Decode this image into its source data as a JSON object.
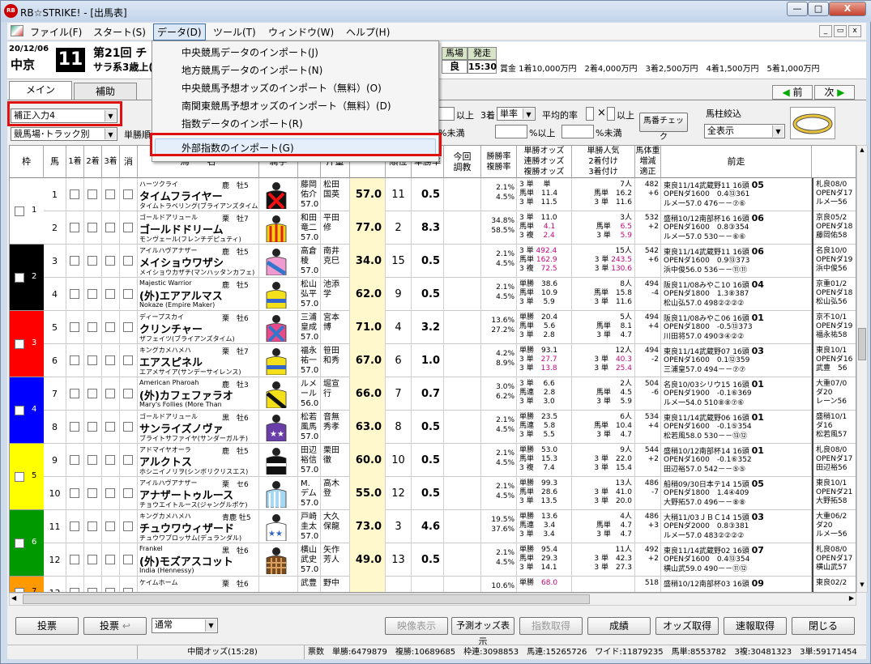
{
  "window": {
    "title": "RB☆STRIKE! - [出馬表]",
    "app_icon": "RB",
    "min": "—",
    "max": "□",
    "close": "X",
    "mdi_min": "_",
    "mdi_restore": "▭",
    "mdi_close": "x"
  },
  "menu": [
    {
      "label": "ファイル(F)"
    },
    {
      "label": "スタート(S)"
    },
    {
      "label": "データ(D)",
      "active": true
    },
    {
      "label": "ツール(T)"
    },
    {
      "label": "ウィンドウ(W)"
    },
    {
      "label": "ヘルプ(H)"
    }
  ],
  "data_menu": {
    "items": [
      "中央競馬データのインポート(J)",
      "地方競馬データのインポート(N)",
      "中央競馬予想オッズのインポート（無料）(O)",
      "南関東競馬予想オッズのインポート（無料）(D)",
      "指数データのインポート(R)",
      "外部指数のインポート(G)"
    ],
    "highlighted_index": 5
  },
  "race": {
    "date": "20/12/06",
    "venue": "中京",
    "number": "11",
    "title": "第21回 チ",
    "cond": "サラ系3歳上(",
    "baba_label": "馬場",
    "baba_value": "良",
    "start_label": "発走",
    "start_value": "15:30",
    "prize": "賞金 1着10,000万円　2着4,000万円　3着2,500万円　4着1,500万円　5着1,000万円"
  },
  "tabs": [
    "メイン",
    "補助"
  ],
  "nav": {
    "prev": "前",
    "next": "次"
  },
  "controls": {
    "correction_select": "補正入力4",
    "baba_track_select": "競馬場･トラック別",
    "win_label": "単勝順",
    "ijo1": "以上",
    "third_label": "3着",
    "rate_select": "単率",
    "avg_rate_label": "平均的率",
    "times": "×",
    "ijo2": "以上",
    "miman1": "%未満",
    "ijo_pct": "%以上",
    "miman2": "%未満",
    "baba_check_btn": "馬番チェック",
    "bachu_label": "馬柱絞込",
    "bachu_select": "全表示"
  },
  "grid_headers": [
    "枠",
    "馬",
    "1着",
    "2着",
    "3着",
    "消",
    "馬　　名",
    "騎手",
    "斤量",
    "順位",
    "単勝率",
    "今回\n調教",
    "勝勝率\n複勝率",
    "単勝オッズ\n連勝オッズ\n複勝オッズ",
    "単勝人気\n2着付け\n3着付け",
    "馬体重\n増減\n適正",
    "前走"
  ],
  "rows": [
    {
      "waku": "1",
      "waku_color": "#ffffff",
      "num": "1",
      "sire": "ハーツクライ",
      "sex": "鹿　牡5",
      "name": "タイムフライヤー",
      "dam": "タイムトラベリング(ブライアンズタイム)",
      "jockey": "藤岡\n佑介\n57.0",
      "trainer": "松田\n国英",
      "wt": "57.0",
      "rank": "11",
      "win": "0.5",
      "p1": "2.1%",
      "p2": "4.5%",
      "odds": "3 単　 単　\n馬単　11.4\n3 単　11.5",
      "pop": "7人\n馬単　16.2\n3 単　11.6",
      "body": "482\n+6",
      "zen": "東良11/14武蔵野11 16頭",
      "zen_no": "05",
      "zen2": "OPENダ1600　0.4⑬361",
      "zen3": "ルメ一57.0 476－－⑦⑥",
      "next": "札良08/0\nOPENダ17\nルメ一56",
      "silk": "x-red"
    },
    {
      "waku": "1",
      "waku_color": "#ffffff",
      "num": "2",
      "sire": "ゴールドアリュール",
      "sex": "栗　牡7",
      "name": "ゴールドドリーム",
      "dam": "モンヴェール(フレンチデピュティ)",
      "jockey": "和田\n竜二\n57.0",
      "trainer": "平田\n修",
      "wt": "77.0",
      "rank": "2",
      "win": "8.3",
      "p1": "34.8%",
      "p2": "58.5%",
      "odds": "3 単　11.0\n馬単　 4.1\n3 複　 2.4",
      "pop": "3人\n馬単　 6.5\n3 単　 5.9",
      "body": "532\n+2",
      "zen": "盛稍10/12南部杯16 16頭",
      "zen_no": "06",
      "zen2": "OPENダ1600　0.8③354",
      "zen3": "ルメ一57.0 530－－⑥⑥",
      "next": "京良05/2\nOPENダ18\n藤岡佑58",
      "silk": "stripe-yr"
    },
    {
      "waku": "2",
      "waku_color": "#000000",
      "num": "3",
      "sire": "アイルハヴアナザー",
      "sex": "鹿　牡5",
      "name": "メイショウワザシ",
      "dam": "メイショウカザチ(マンハッタンカフェ)",
      "jockey": "高倉\n稜\n57.0",
      "trainer": "南井\n克巳",
      "wt": "34.0",
      "rank": "15",
      "win": "0.5",
      "p1": "2.1%",
      "p2": "4.5%",
      "odds": "3 単 492.4\n馬単 162.9\n3 複　72.5",
      "pop": "15人\n3 単 243.5\n3 単 130.6",
      "body": "542\n+6",
      "zen": "東良11/14武蔵野11 16頭",
      "zen_no": "06",
      "zen2": "OPENダ1600　0.9⑬373",
      "zen3": "浜中俊56.0 536－－⑪⑪",
      "next": "名良10/0\nOPENダ19\n浜中俊56",
      "silk": "pink-blue"
    },
    {
      "waku": "2",
      "waku_color": "#000000",
      "num": "4",
      "sire": "Majestic Warrior",
      "sex": "鹿　牡5",
      "name": "(外)エアアルマス",
      "dam": "Nokaze (Empire Maker)",
      "jockey": "松山\n弘平\n57.0",
      "trainer": "池添\n学",
      "wt": "62.0",
      "rank": "9",
      "win": "0.5",
      "p1": "2.1%",
      "p2": "4.5%",
      "odds": "単勝　38.6\n馬単　10.9\n3 単　 5.9",
      "pop": "8人\n馬単　15.8\n3 単　11.6",
      "body": "494\n-4",
      "zen": "阪良11/08みやこ10 16頭",
      "zen_no": "04",
      "zen2": "OPENダ1800　1.3⑧387",
      "zen3": "松山弘57.0 498②②②②",
      "next": "京重01/2\nOPENダ18\n松山弘56",
      "silk": "yellow"
    },
    {
      "waku": "3",
      "waku_color": "#ff0000",
      "num": "5",
      "sire": "ディープスカイ",
      "sex": "栗　牡6",
      "name": "クリンチャー",
      "dam": "ザフェイツ(ブライアンズタイム)",
      "jockey": "三浦\n皇成\n57.0",
      "trainer": "宮本\n博",
      "wt": "71.0",
      "rank": "4",
      "win": "3.2",
      "p1": "13.6%",
      "p2": "27.2%",
      "odds": "単勝　20.4\n馬単　 5.6\n3 単　 2.8",
      "pop": "5人\n馬単　 8.1\n3 単　 4.7",
      "body": "494\n+4",
      "zen": "阪良11/08みやこ06 16頭",
      "zen_no": "01",
      "zen2": "OPENダ1800　-0.5⑬373",
      "zen3": "川田将57.0 490③④②②",
      "next": "京不10/1\nOPENダ19\n福永祐58",
      "silk": "x-blue"
    },
    {
      "waku": "3",
      "waku_color": "#ff0000",
      "num": "6",
      "sire": "キングカメハメハ",
      "sex": "栗　牡7",
      "name": "エアスピネル",
      "dam": "エアメサイア(サンデーサイレンス)",
      "jockey": "福永\n祐一\n57.0",
      "trainer": "笹田\n和秀",
      "wt": "67.0",
      "rank": "6",
      "win": "1.0",
      "p1": "4.2%",
      "p2": "8.9%",
      "odds": "単勝　93.1\n3 単　27.7\n3 単　13.8",
      "pop": "12人\n3 単　40.3\n3 単　25.4",
      "body": "494\n-2",
      "zen": "東良11/14武蔵野07 16頭",
      "zen_no": "03",
      "zen2": "OPENダ1600　0.1⑫359",
      "zen3": "三浦皇57.0 494－－⑦⑦",
      "next": "東良10/1\nOPENダ16\n武豊　56",
      "silk": "yellow-dot"
    },
    {
      "waku": "4",
      "waku_color": "#0000ff",
      "num": "7",
      "sire": "American Pharoah",
      "sex": "鹿　牡3",
      "name": "(外)カフェファラオ",
      "dam": "Mary's Follies (More Than",
      "jockey": "ルメ\nール\n56.0",
      "trainer": "堀宣\n行",
      "wt": "66.0",
      "rank": "7",
      "win": "0.7",
      "p1": "3.0%",
      "p2": "6.2%",
      "odds": "3 単　 6.6\n馬連　 2.8\n3 単　 3.0",
      "pop": "2人\n馬単　 4.5\n3 単　 5.9",
      "body": "504\n-6",
      "zen": "名良10/03シリウ15 16頭",
      "zen_no": "01",
      "zen2": "OPENダ1900　-0.1⑥369",
      "zen3": "ルメ一54.0 510⑧⑧⑦⑥",
      "next": "大重07/0\nダ20\nレーン56",
      "silk": "yellow-black"
    },
    {
      "waku": "4",
      "waku_color": "#0000ff",
      "num": "8",
      "sire": "ゴールドアリュール",
      "sex": "黒　牡6",
      "name": "サンライズノヴァ",
      "dam": "ブライトサファイヤ(サンダーガルチ)",
      "jockey": "松若\n風馬\n57.0",
      "trainer": "音無\n秀孝",
      "wt": "63.0",
      "rank": "8",
      "win": "0.5",
      "p1": "2.1%",
      "p2": "4.5%",
      "odds": "単勝　23.5\n馬連　 5.8\n3 単　 5.5",
      "pop": "6人\n馬単　10.4\n3 単　 4.7",
      "body": "534\n+4",
      "zen": "東良11/14武蔵野06 16頭",
      "zen_no": "01",
      "zen2": "OPENダ1600　-0.1⑤354",
      "zen3": "松若風58.0 530－－⑬⑫",
      "next": "盛稍10/1\nダ16\n松若風57",
      "silk": "purple-star"
    },
    {
      "waku": "5",
      "waku_color": "#ffff00",
      "num": "9",
      "sire": "アドマイヤオーラ",
      "sex": "鹿　牡5",
      "name": "アルクトス",
      "dam": "ホシニイノリヲ(シンボリクリスエス)",
      "jockey": "田辺\n裕信\n57.0",
      "trainer": "栗田\n徹",
      "wt": "60.0",
      "rank": "10",
      "win": "0.5",
      "p1": "2.1%",
      "p2": "4.5%",
      "odds": "単勝　53.0\n馬単　15.3\n3 複　 7.4",
      "pop": "9人\n3 単　22.0\n3 単　15.4",
      "body": "544\n+2",
      "zen": "盛稍10/12南部杯14 16頭",
      "zen_no": "01",
      "zen2": "OPENダ1600　-0.1⑥352",
      "zen3": "田辺裕57.0 542－－⑤⑤",
      "next": "札良08/0\nOPENダ17\n田辺裕56",
      "silk": "black-white"
    },
    {
      "waku": "5",
      "waku_color": "#ffff00",
      "num": "10",
      "sire": "アイルハヴアナザー",
      "sex": "栗　セ6",
      "name": "アナザートゥルース",
      "dam": "チョウエイトルース(ジャングルポケ)",
      "jockey": "M.\nデム\n57.0",
      "trainer": "高木\n登",
      "wt": "55.0",
      "rank": "12",
      "win": "0.5",
      "p1": "2.1%",
      "p2": "4.5%",
      "odds": "単勝　99.3\n馬単　28.6\n3 単　13.5",
      "pop": "13人\n3 単　41.0\n3 単　20.0",
      "body": "486\n-7",
      "zen": "船稍09/30日本テ14 15頭",
      "zen_no": "05",
      "zen2": "OPENダ1800　1.4④409",
      "zen3": "大野拓57.0 496－－⑧⑧",
      "next": "東良10/1\nOPENダ21\n大野拓58",
      "silk": "lightblue"
    },
    {
      "waku": "6",
      "waku_color": "#009900",
      "num": "11",
      "sire": "キングカメハメハ",
      "sex": "青鹿 牡5",
      "name": "チュウワウィザード",
      "dam": "チュウワブロッサム(デュランダル)",
      "jockey": "戸崎\n圭太\n57.0",
      "trainer": "大久\n保龍",
      "wt": "73.0",
      "rank": "3",
      "win": "4.6",
      "p1": "19.5%",
      "p2": "37.6%",
      "odds": "単勝　13.6\n馬連　 3.4\n3 単　 3.4",
      "pop": "4人\n馬単　 4.7\n3 単　 4.7",
      "body": "486\n+3",
      "zen": "大稍11/03ＪＢＣ14 15頭",
      "zen_no": "03",
      "zen2": "OPENダ2000　0.8③381",
      "zen3": "ルメ一57.0 483②②②②",
      "next": "大重06/2\nダ20\nルメ一56",
      "silk": "white-blue-star"
    },
    {
      "waku": "6",
      "waku_color": "#009900",
      "num": "12",
      "sire": "Frankel",
      "sex": "黒　牡6",
      "name": "(外)モズアスコット",
      "dam": "India (Hennessy)",
      "jockey": "横山\n武史\n57.0",
      "trainer": "矢作\n芳人",
      "wt": "49.0",
      "rank": "13",
      "win": "0.5",
      "p1": "2.1%",
      "p2": "4.5%",
      "odds": "単勝　95.4\n馬単　29.3\n3 単　14.1",
      "pop": "11人\n3 単　42.3\n3 単　27.3",
      "body": "492\n+2",
      "zen": "東良11/14武蔵野02 16頭",
      "zen_no": "07",
      "zen2": "OPENダ1600　0.4⑬354",
      "zen3": "横山武59.0 490－－⑪⑫",
      "next": "札良08/0\nOPENダ17\n横山武57",
      "silk": "brown-check"
    },
    {
      "waku": "7",
      "waku_color": "#ff9900",
      "num": "13",
      "sire": "ケイムホーム",
      "sex": "栗　牡6",
      "name": "",
      "dam": "",
      "jockey": "武豊",
      "trainer": "野中",
      "wt": "",
      "rank": "",
      "win": "",
      "p1": "10.6%",
      "p2": "",
      "odds": "単勝　68.0",
      "pop": "",
      "body": "518",
      "zen": "盛稍10/12南部杯03 16頭",
      "zen_no": "09",
      "zen2": "",
      "zen3": "",
      "next": "東良02/2",
      "silk": "none"
    }
  ],
  "buttons": {
    "vote1": "投票",
    "vote2": "投票",
    "vote_select": "通常",
    "video": "映像表示",
    "pred_odds": "予測オッズ表示",
    "index_get": "指数取得",
    "seiseki": "成績",
    "odds_get": "オッズ取得",
    "sokuho": "速報取得",
    "close": "閉じる"
  },
  "status": {
    "odds_time": "中間オッズ(15:28)",
    "votes": "票数　単勝:6479879　複勝:10689685　枠連:3098853　馬連:15265726　ワイド:11879235　馬単:8553782　3複:30481323　3単:59171454"
  }
}
